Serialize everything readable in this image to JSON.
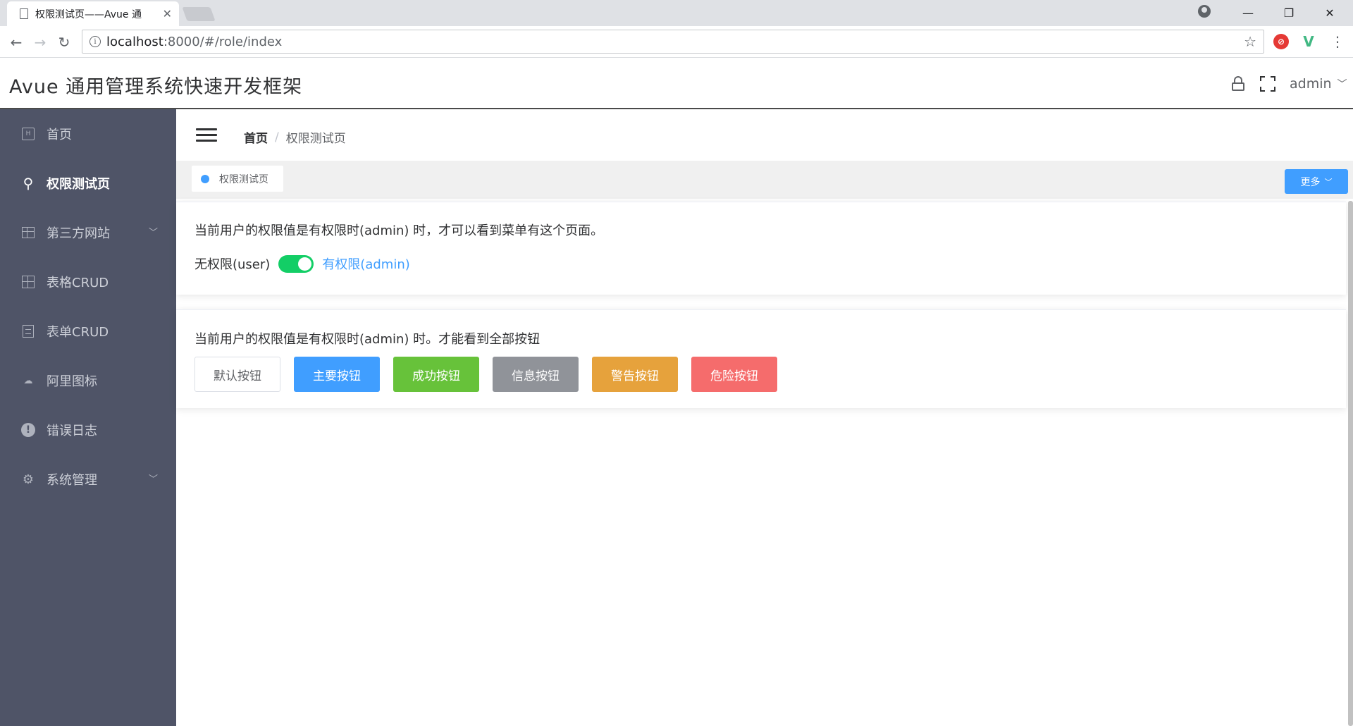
{
  "browser": {
    "tab_title": "权限测试页——Avue 通",
    "url_host": "localhost",
    "url_path": ":8000/#/role/index"
  },
  "app": {
    "title": "Avue 通用管理系统快速开发框架",
    "user": "admin"
  },
  "sidebar": {
    "items": [
      {
        "label": "首页",
        "icon": "home-box-icon"
      },
      {
        "label": "权限测试页",
        "icon": "key-icon"
      },
      {
        "label": "第三方网站",
        "icon": "layout-icon"
      },
      {
        "label": "表格CRUD",
        "icon": "table-icon"
      },
      {
        "label": "表单CRUD",
        "icon": "form-icon"
      },
      {
        "label": "阿里图标",
        "icon": "cloud-icon"
      },
      {
        "label": "错误日志",
        "icon": "error-icon"
      },
      {
        "label": "系统管理",
        "icon": "gear-icon"
      }
    ]
  },
  "breadcrumb": {
    "home": "首页",
    "separator": "/",
    "current": "权限测试页"
  },
  "tags": {
    "active": "权限测试页",
    "more": "更多"
  },
  "card1": {
    "text": "当前用户的权限值是有权限时(admin) 时，才可以看到菜单有这个页面。",
    "switch_off_label": "无权限(user)",
    "switch_on_label": "有权限(admin)",
    "switch_on": true
  },
  "card2": {
    "text": "当前用户的权限值是有权限时(admin) 时。才能看到全部按钮",
    "buttons": [
      "默认按钮",
      "主要按钮",
      "成功按钮",
      "信息按钮",
      "警告按钮",
      "危险按钮"
    ]
  },
  "colors": {
    "sidebar_bg": "#4f5467",
    "primary": "#409eff",
    "success": "#67c23a",
    "info": "#909399",
    "warning": "#e6a23c",
    "danger": "#f56c6c",
    "switch_on": "#13ce66"
  }
}
